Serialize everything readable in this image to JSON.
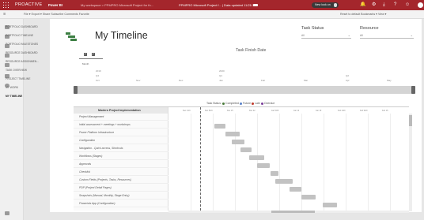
{
  "header": {
    "app_name": "PROACTIVE",
    "project": "Power BI",
    "workspace": "My workspace  >  PPMPRO Microsoft Project for th...",
    "file_title": "PPMPRO Microsoft Project f...  |  Data updated 11/21/19",
    "new_look": "New look on",
    "icons": [
      "bell-icon",
      "settings-icon",
      "download-icon",
      "help-icon",
      "smiley-icon"
    ],
    "brand_color": "#a4262c"
  },
  "toolbar": {
    "left": "File  ▾   Export  ▾   Share   Subscribe   Comments   Favorite",
    "right": "Reset to default     Bookmarks  ▾    View  ▾"
  },
  "nav_pages": [
    "PORTFOLIO DASHBOARD",
    "PORTFOLIO TIMELINE",
    "PORTFOLIO MILESTONES",
    "RESOURCE DASHBOARD",
    "RESOURCE ASSIGNMEN...",
    "TASK OVERVIEW",
    "PROJECT TIMELINE",
    "MY WORK",
    "MY TIMELINE"
  ],
  "active_page": "MY TIMELINE",
  "report": {
    "title": "My Timeline",
    "task_status": {
      "label": "Task Status",
      "value": "All"
    },
    "resource": {
      "label": "Resource",
      "value": "All"
    },
    "task_finish_date": "Task Finish Date",
    "zoom_label": "Month"
  },
  "timeline_labels": [
    {
      "text": "2019"
    },
    {
      "text": "Q4"
    },
    {
      "text": "Oct"
    },
    {
      "text": "Nov"
    },
    {
      "text": "Dec"
    },
    {
      "text": "2020"
    },
    {
      "text": "Q1"
    },
    {
      "text": "Jan"
    },
    {
      "text": "Feb"
    },
    {
      "text": "Mar"
    },
    {
      "text": "Q2"
    },
    {
      "text": "Apr"
    },
    {
      "text": "May"
    }
  ],
  "legend": {
    "label": "Task Status",
    "items": [
      {
        "label": "Completed",
        "color": "#4a7a3a"
      },
      {
        "label": "Future",
        "color": "#5a82c9"
      },
      {
        "label": "Late",
        "color": "#c0392b"
      },
      {
        "label": "Overdue",
        "color": "#7a3e9a"
      }
    ]
  },
  "gantt": {
    "header": "Modern Project Implementation",
    "rows": [
      "Project Management",
      "Initial assessment + meetings + workshops",
      "Power Platform Infrastructure",
      "Configuration",
      "Navigation - Quick access, Shortcuts",
      "Workflows (Stages)",
      "Approvals",
      "Checklist",
      "Custom Fields (Projects, Tasks, Resources)",
      "PDP (Project Detail Pages)",
      "Snapshots (Manual, Monthly, Stage Entry)",
      "Financials App (Configuration)"
    ],
    "date_headers": [
      "Dec 1/19",
      "Dec 8/19",
      "Dec 15",
      "Dec 22",
      "Jan 5/20",
      "Jan 12",
      "Jan 19",
      "Feb 2/20",
      "Feb 9/20",
      "Feb 16"
    ]
  }
}
